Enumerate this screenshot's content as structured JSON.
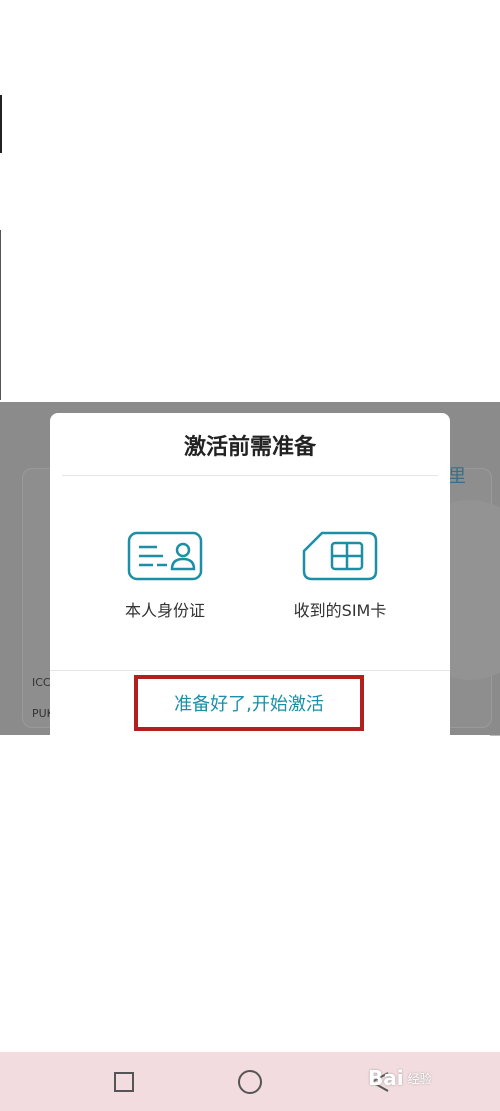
{
  "dialog": {
    "title": "激活前需准备",
    "items": [
      {
        "label": "本人身份证",
        "icon": "id-card-icon"
      },
      {
        "label": "收到的SIM卡",
        "icon": "sim-card-icon"
      }
    ],
    "start_button_label": "准备好了,开始激活"
  },
  "background": {
    "link_partial": "里",
    "label_1": "ICC",
    "label_2": "PUK"
  },
  "nav_bar": {
    "recent_icon": "square-icon",
    "home_icon": "circle-icon",
    "back_icon": "triangle-back-icon"
  },
  "watermark": {
    "text": "Bai",
    "sub": "经验"
  },
  "colors": {
    "accent": "#1c8fa6",
    "highlight_border": "#b11f1f",
    "dim_overlay": "#8b8b8b",
    "nav_bar_bg": "#f3dcdf"
  }
}
